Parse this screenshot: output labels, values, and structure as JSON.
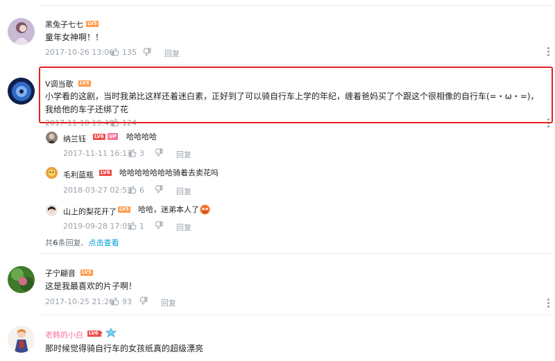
{
  "comments": [
    {
      "username": "黑兔子七七",
      "level": "LV5",
      "text": "童年女神啊！！",
      "date": "2017-10-26 13:06",
      "likes": "135",
      "reply_label": "回复"
    },
    {
      "username": "V调当歌",
      "level": "LV5",
      "text": "小学看的这剧，当时我弟比这样还着迷白素，正好到了可以骑自行车上学的年纪，缠着爸妈买了个跟这个很相像的自行车(=・ω・=)，我给他的车子还绑了花",
      "date": "2017-11-10 19:49",
      "likes": "124",
      "reply_label": "回复",
      "replies": [
        {
          "username": "纳兰钰",
          "level": "LV6",
          "badge": "UP",
          "text": "哈哈哈哈",
          "date": "2017-11-11 16:17",
          "likes": "3",
          "reply_label": "回复"
        },
        {
          "username": "毛利蓝瓶",
          "level": "LV6",
          "text": "哈哈哈哈哈哈哈骑着去卖花吗",
          "date": "2018-03-27 02:53",
          "likes": "6",
          "reply_label": "回复"
        },
        {
          "username": "山上的梨花开了",
          "level": "LV5",
          "text": "哈哈，迷弟本人了",
          "date": "2019-09-28 17:05",
          "likes": "1",
          "reply_label": "回复"
        }
      ],
      "more": {
        "prefix": "共",
        "count": "6",
        "suffix": "条回复,",
        "link": "点击查看"
      }
    },
    {
      "username": "子宁翩音",
      "level": "LV5",
      "text": "这是我最喜欢的片子啊！",
      "date": "2017-10-25 21:26",
      "likes": "93",
      "reply_label": "回复"
    },
    {
      "username": "老韩的小白",
      "level": "LV6",
      "text": "那时候觉得骑自行车的女孩纸真的超级漂亮"
    }
  ],
  "colors": {
    "highlight_border": "#e4211e",
    "lv5": "#ff9a4b",
    "lv6": "#f04c49",
    "up_badge": "#fb7299",
    "link": "#00a1d6",
    "meta": "#99a2aa"
  }
}
